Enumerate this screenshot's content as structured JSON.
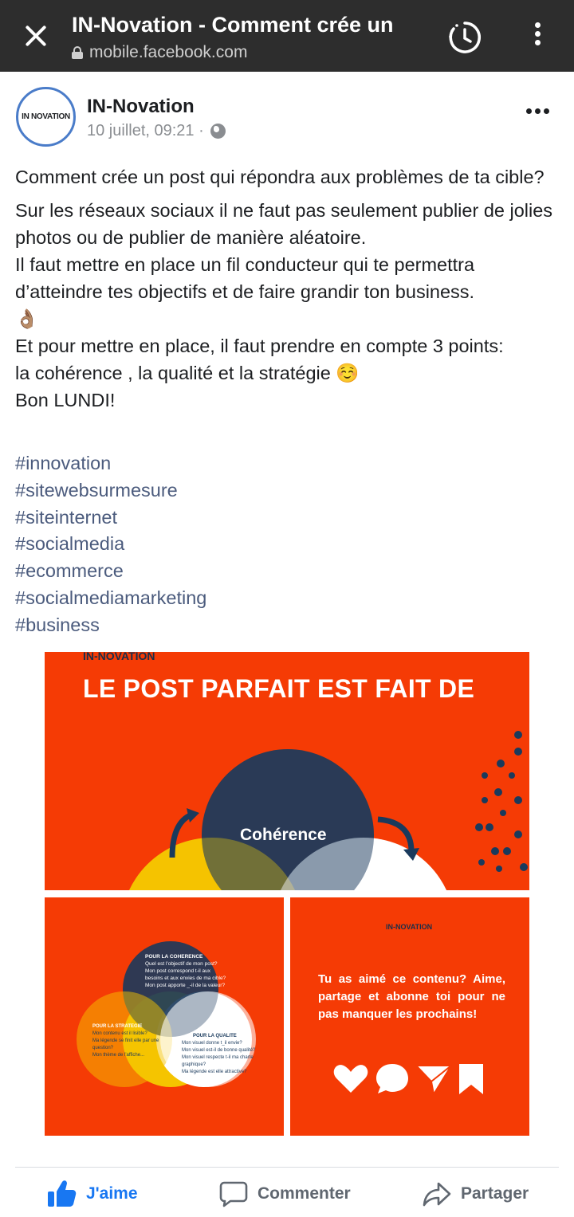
{
  "browser": {
    "title": "IN-Novation - Comment crée un",
    "url": "mobile.facebook.com"
  },
  "post": {
    "page_name": "IN-Novation",
    "avatar_logo": "IN NOVATION",
    "timestamp": "10 juillet, 09:21 ·",
    "paragraphs": [
      "Comment crée un post qui répondra aux problèmes de ta cible?",
      "Sur les réseaux sociaux il ne faut pas seulement publier de jolies photos ou de publier de manière aléatoire.",
      "Il faut mettre en place un fil conducteur qui te permettra d’atteindre tes objectifs et de faire grandir ton business.",
      "👌🏽",
      "Et pour mettre en place, il faut prendre en compte 3 points:",
      "la cohérence , la qualité et la stratégie ☺️",
      "Bon LUNDI!"
    ],
    "hashtags": [
      "#innovation",
      "#sitewebsurmesure",
      "#siteinternet",
      "#socialmedia",
      "#ecommerce",
      "#socialmediamarketing",
      "#business"
    ]
  },
  "image_main": {
    "logo": "IN-NOVATION",
    "headline": "LE POST PARFAIT EST FAIT DE",
    "circle_label": "Cohérence"
  },
  "image_left": {
    "coherence_title": "POUR LA COHERENCE",
    "coherence_lines": [
      "Quel est l'objectif de mon post?",
      "Mon post correspond t-il aux",
      "besoins et aux envies de ma cible?",
      "Mon post apporte _-il de la valeur?"
    ],
    "strategie_title": "POUR LA STRATEGIE",
    "strategie_lines": [
      "Mon contenu est il lisible?",
      "Ma légende se finit elle par une",
      "question?",
      "Mon thème de l'affiche..."
    ],
    "qualite_title": "POUR LA QUALITE",
    "qualite_lines": [
      "Mon visuel donne t_il envie?",
      "Mon visuel est-il de bonne qualité?",
      "Mon visuel respecte t-il ma charte",
      "graphique?",
      "Ma légende est elle attractive?"
    ]
  },
  "image_right": {
    "logo": "IN-NOVATION",
    "cta": "Tu as aimé ce contenu? Aime, partage et abonne toi pour ne pas manquer les prochains!"
  },
  "actions": {
    "like": "J'aime",
    "comment": "Commenter",
    "share": "Partager"
  },
  "colors": {
    "topbar": "#2d2d2d",
    "brand_orange": "#f53b05",
    "navy": "#1a3a5c",
    "like_blue": "#1877f2",
    "hashtag": "#4b5b7d"
  }
}
